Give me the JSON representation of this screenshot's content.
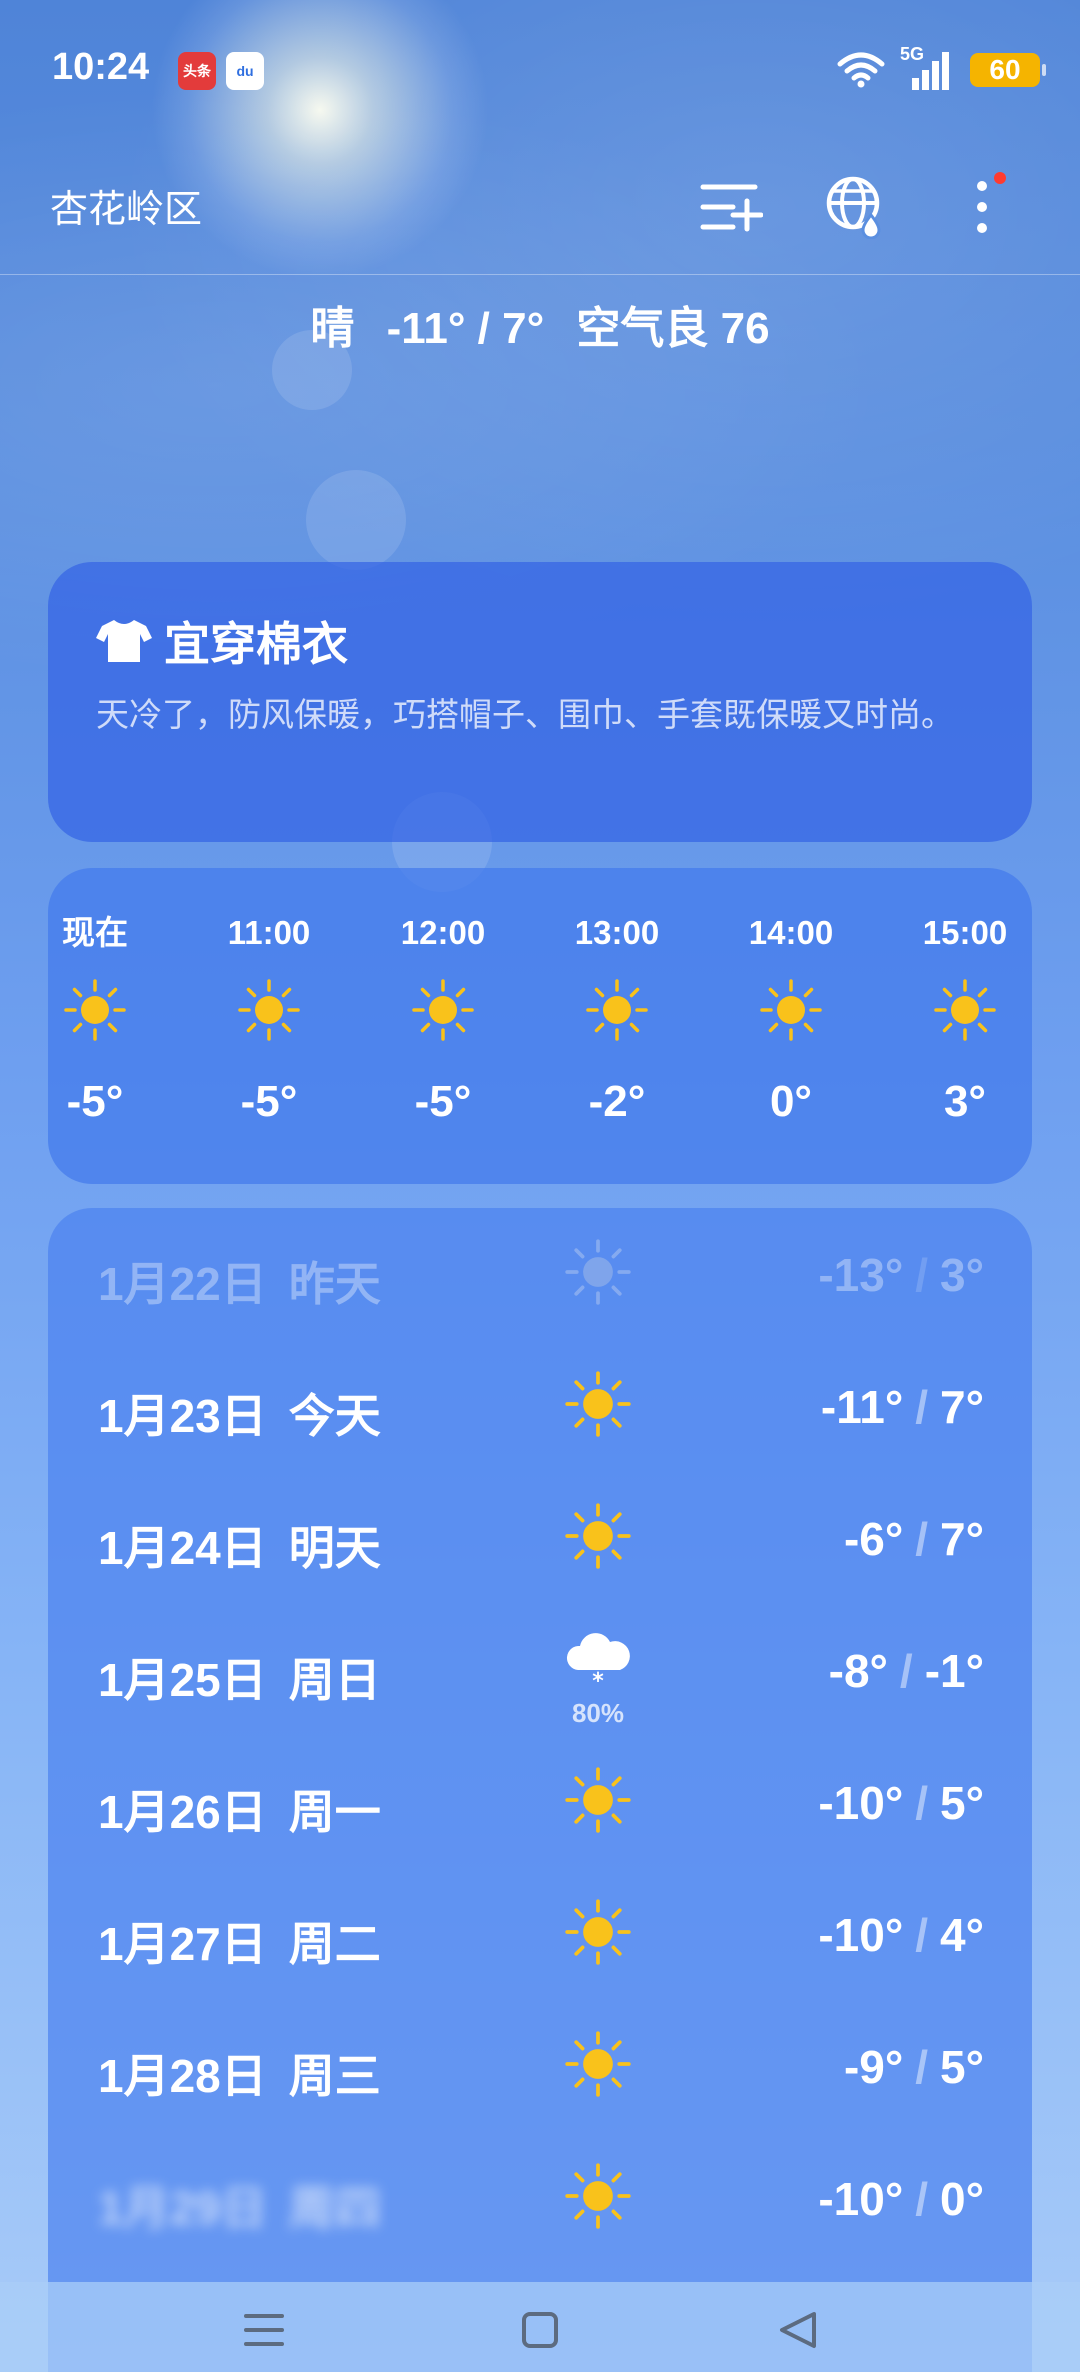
{
  "status_bar": {
    "time": "10:24",
    "badges": [
      "头条",
      "du"
    ],
    "network": "5G",
    "battery": "60"
  },
  "header": {
    "location": "杏花岭区",
    "icons": [
      "city-list-add-icon",
      "globe-drop-icon",
      "more-vertical-icon"
    ]
  },
  "summary": {
    "condition": "晴",
    "temp_range": "-11° / 7°",
    "air_quality": "空气良 76"
  },
  "advice": {
    "icon": "shirt-icon",
    "title": "宜穿棉衣",
    "text": "天冷了，防风保暖，巧搭帽子、围巾、手套既保暖又时尚。"
  },
  "hourly": [
    {
      "time": "现在",
      "icon": "sun-icon",
      "temp": "-5°"
    },
    {
      "time": "11:00",
      "icon": "sun-icon",
      "temp": "-5°"
    },
    {
      "time": "12:00",
      "icon": "sun-icon",
      "temp": "-5°"
    },
    {
      "time": "13:00",
      "icon": "sun-icon",
      "temp": "-2°"
    },
    {
      "time": "14:00",
      "icon": "sun-icon",
      "temp": "0°"
    },
    {
      "time": "15:00",
      "icon": "sun-icon",
      "temp": "3°"
    }
  ],
  "daily": [
    {
      "date": "1月22日",
      "name": "昨天",
      "icon": "sun-icon",
      "low": "-13°",
      "high": "3°"
    },
    {
      "date": "1月23日",
      "name": "今天",
      "icon": "sun-icon",
      "low": "-11°",
      "high": "7°"
    },
    {
      "date": "1月24日",
      "name": "明天",
      "icon": "sun-icon",
      "low": "-6°",
      "high": "7°"
    },
    {
      "date": "1月25日",
      "name": "周日",
      "icon": "snow-cloud-icon",
      "precip": "80%",
      "low": "-8°",
      "high": "-1°"
    },
    {
      "date": "1月26日",
      "name": "周一",
      "icon": "sun-icon",
      "low": "-10°",
      "high": "5°"
    },
    {
      "date": "1月27日",
      "name": "周二",
      "icon": "sun-icon",
      "low": "-10°",
      "high": "4°"
    },
    {
      "date": "1月28日",
      "name": "周三",
      "icon": "sun-icon",
      "low": "-9°",
      "high": "5°"
    },
    {
      "date": "1月29日",
      "name": "周四",
      "icon": "sun-icon",
      "low": "-10°",
      "high": "0°"
    }
  ],
  "nav": [
    "menu-icon",
    "home-square-icon",
    "back-triangle-icon"
  ],
  "colors": {
    "sun": "#f9c21b",
    "battery": "#f5b400",
    "notification_dot": "#ff3b30"
  }
}
